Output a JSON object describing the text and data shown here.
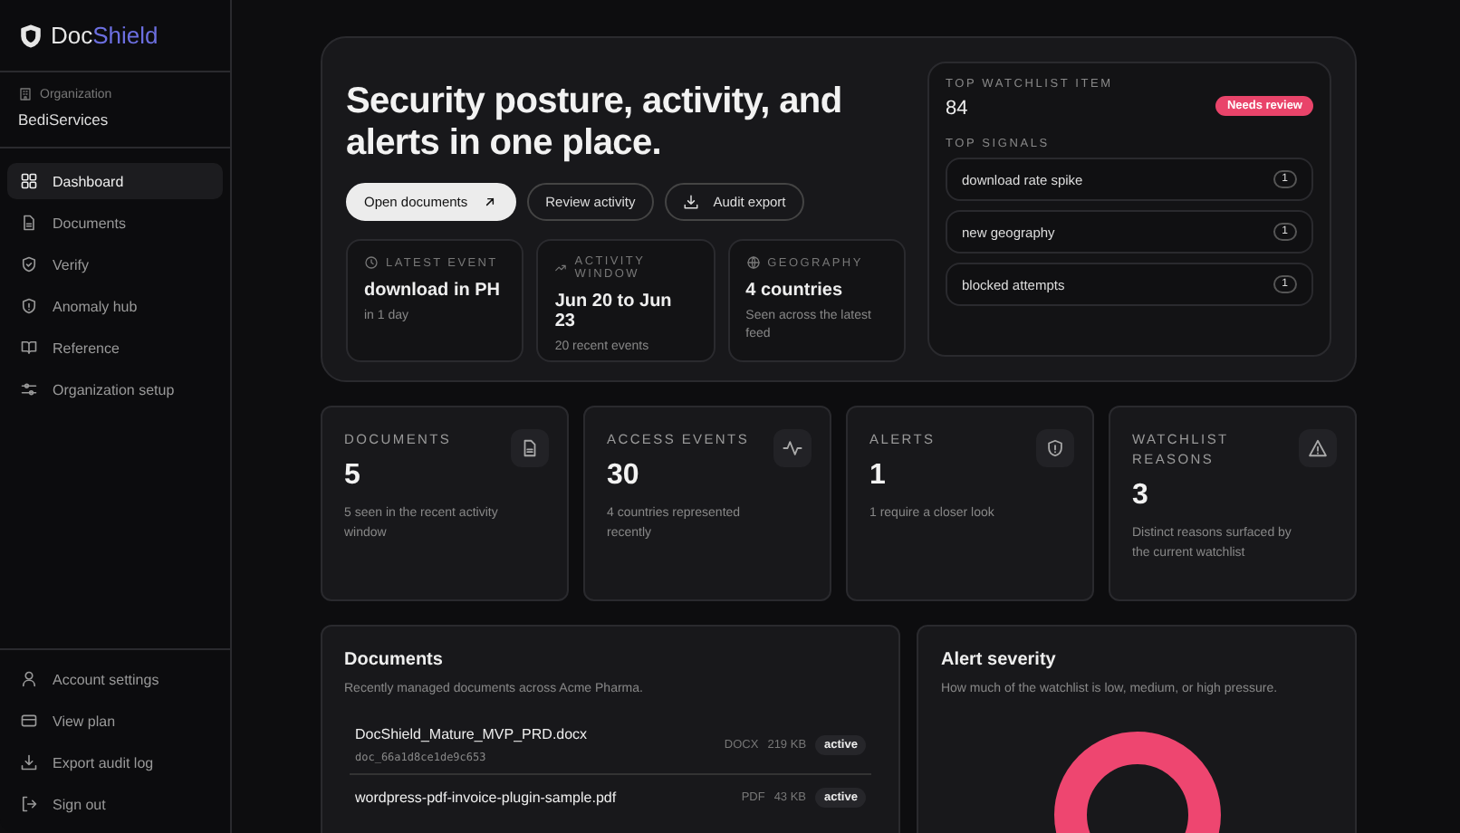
{
  "brand": {
    "prefix": "Doc",
    "suffix": "Shield"
  },
  "organization": {
    "label": "Organization",
    "name": "BediServices"
  },
  "nav": [
    {
      "label": "Dashboard",
      "selected": true
    },
    {
      "label": "Documents",
      "selected": false
    },
    {
      "label": "Verify",
      "selected": false
    },
    {
      "label": "Anomaly hub",
      "selected": false
    },
    {
      "label": "Reference",
      "selected": false
    },
    {
      "label": "Organization setup",
      "selected": false
    }
  ],
  "footer_nav": [
    "Account settings",
    "View plan",
    "Export audit log",
    "Sign out"
  ],
  "hero": {
    "title": "Security posture, activity, and alerts in one place.",
    "buttons": [
      {
        "label": "Open documents",
        "kind": "primary"
      },
      {
        "label": "Review activity",
        "kind": "outline"
      },
      {
        "label": "Audit export",
        "kind": "download"
      }
    ],
    "info_cards": [
      {
        "label": "LATEST EVENT",
        "value": "download in PH",
        "sub": "in 1 day"
      },
      {
        "label": "ACTIVITY WINDOW",
        "value": "Jun 20 to Jun 23",
        "sub": "20 recent events"
      },
      {
        "label": "GEOGRAPHY",
        "value": "4 countries",
        "sub": "Seen across the latest feed"
      }
    ],
    "watchlist": {
      "label": "TOP WATCHLIST ITEM",
      "value": "84",
      "badge": "Needs review",
      "signals_label": "TOP SIGNALS",
      "signals": [
        {
          "label": "download rate spike",
          "count": "1"
        },
        {
          "label": "new geography",
          "count": "1"
        },
        {
          "label": "blocked attempts",
          "count": "1"
        }
      ]
    }
  },
  "stats": [
    {
      "label": "DOCUMENTS",
      "value": "5",
      "sub": "5 seen in the recent activity window"
    },
    {
      "label": "ACCESS EVENTS",
      "value": "30",
      "sub": "4 countries represented recently"
    },
    {
      "label": "ALERTS",
      "value": "1",
      "sub": "1 require a closer look"
    },
    {
      "label": "WATCHLIST REASONS",
      "value": "3",
      "sub": "Distinct reasons surfaced by the current watchlist"
    }
  ],
  "documents": {
    "title": "Documents",
    "subtitle": "Recently managed documents across Acme Pharma.",
    "rows": [
      {
        "name": "DocShield_Mature_MVP_PRD.docx",
        "id": "doc_66a1d8ce1de9c653",
        "type": "DOCX",
        "size": "219 KB",
        "status": "active"
      },
      {
        "name": "wordpress-pdf-invoice-plugin-sample.pdf",
        "type": "PDF",
        "size": "43 KB",
        "status": "active"
      }
    ]
  },
  "severity": {
    "title": "Alert severity",
    "subtitle": "How much of the watchlist is low, medium, or high pressure."
  }
}
